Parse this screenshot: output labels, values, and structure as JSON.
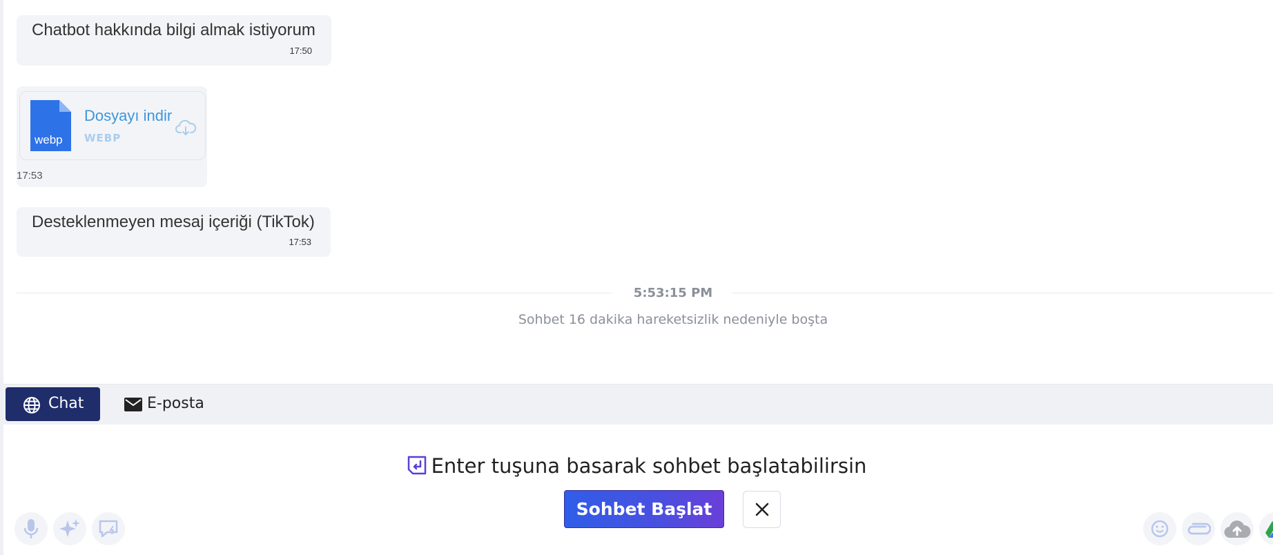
{
  "messages": [
    {
      "text": "Chatbot hakkında bilgi almak istiyorum",
      "time": "17:50"
    },
    {
      "file_name": "Dosyayı indir",
      "file_type": "WEBP",
      "file_ext": "webp",
      "time": "17:53"
    },
    {
      "text": "Desteklenmeyen mesaj içeriği (TikTok)",
      "time": "17:53"
    }
  ],
  "separator": {
    "time": "5:53:15 PM",
    "note": "Sohbet 16 dakika hareketsizlik nedeniyle boşta"
  },
  "tabs": [
    {
      "label": "Chat",
      "icon": "globe-icon",
      "active": true
    },
    {
      "label": "E-posta",
      "icon": "mail-icon",
      "active": false
    }
  ],
  "composer": {
    "hint": "Enter tuşuna basarak sohbet başlatabilirsin",
    "start_button": "Sohbet Başlat",
    "left_tools": [
      "microphone-icon",
      "sparkles-icon",
      "quick-reply-icon"
    ],
    "right_tools": [
      "emoji-icon",
      "attachment-icon",
      "cloud-upload-icon",
      "google-drive-icon"
    ]
  },
  "colors": {
    "accent_navy": "#1f2d6b",
    "button_gradient_start": "#2f5ee8",
    "button_gradient_end": "#6a3fd8",
    "link_blue": "#3d96dc",
    "file_icon_blue": "#2e72e8"
  }
}
